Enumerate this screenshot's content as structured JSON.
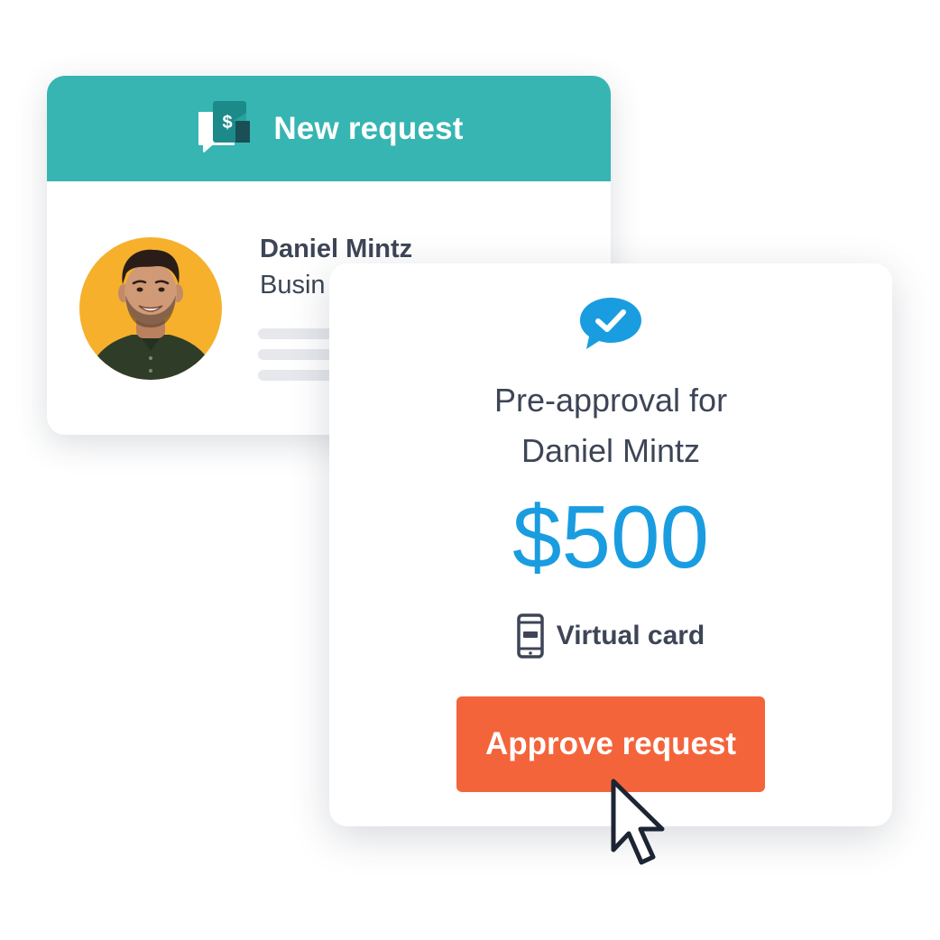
{
  "request_card": {
    "title": "New request",
    "header_icon": "dollar-chat-icon",
    "requester_name": "Daniel Mintz",
    "requester_role": "Busin"
  },
  "approval_card": {
    "status_icon": "check-bubble-icon",
    "title_line_1": "Pre-approval for",
    "title_line_2": "Daniel Mintz",
    "amount": "$500",
    "card_type_icon": "mobile-phone-icon",
    "card_type": "Virtual card",
    "approve_label": "Approve request"
  },
  "colors": {
    "header_teal": "#36b5b2",
    "amount_blue": "#1a9de0",
    "approve_orange": "#f4643b",
    "avatar_yellow": "#f6b02c",
    "text_dark": "#3d4556"
  }
}
